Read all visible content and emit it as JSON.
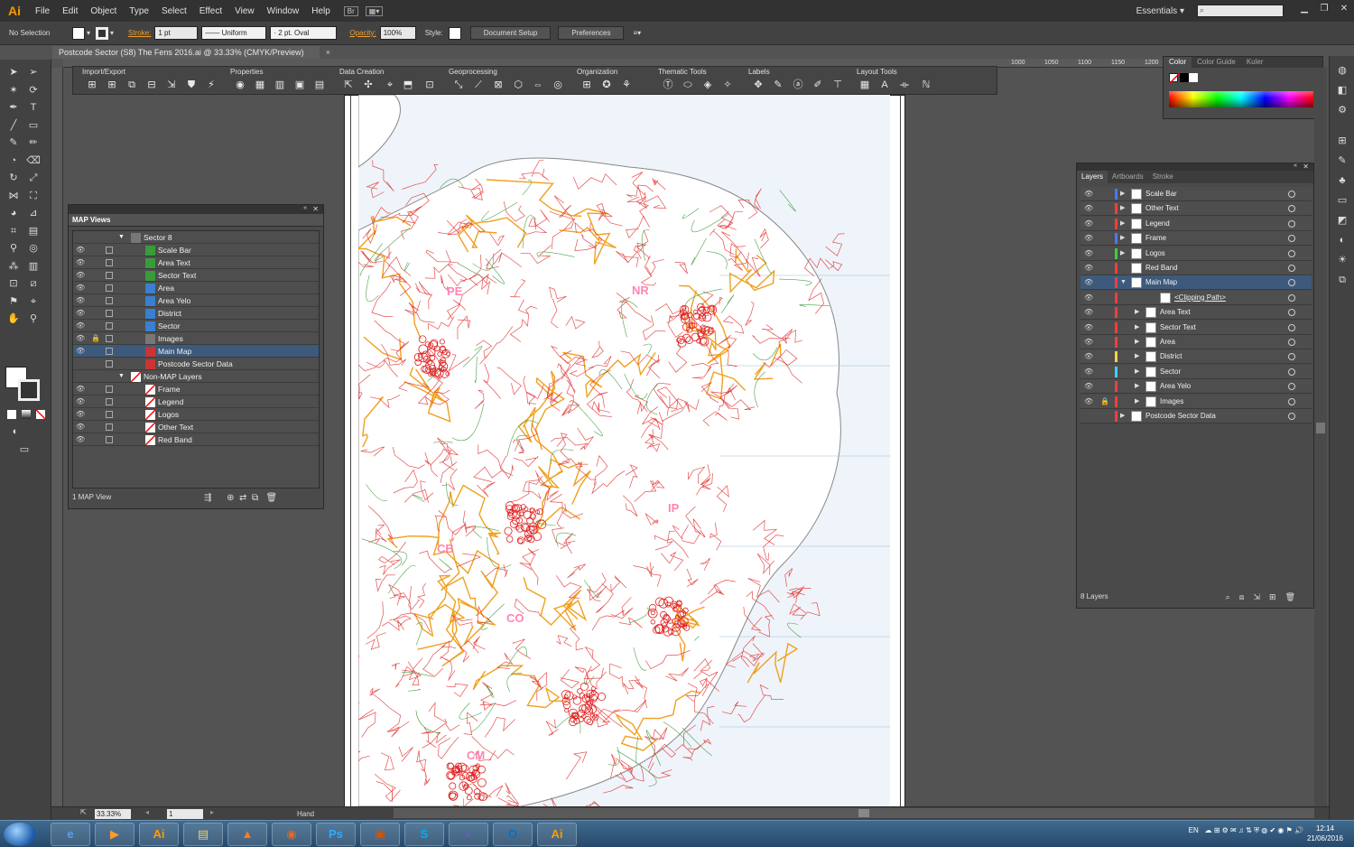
{
  "app": {
    "logo": "Ai",
    "workspace": "Essentials"
  },
  "menu": [
    "File",
    "Edit",
    "Object",
    "Type",
    "Select",
    "Effect",
    "View",
    "Window",
    "Help"
  ],
  "menu_extras": {
    "bridge": "Br"
  },
  "control": {
    "selection": "No Selection",
    "stroke_label": "Stroke:",
    "stroke_weight": "1 pt",
    "profile": "Uniform",
    "brush": "2 pt. Oval",
    "opacity_label": "Opacity:",
    "opacity": "100%",
    "style_label": "Style:",
    "document_setup": "Document Setup",
    "preferences": "Preferences"
  },
  "document": {
    "tab": "Postcode Sector (S8) The Fens 2016.ai @ 33.33% (CMYK/Preview)",
    "close": "×"
  },
  "ruler_ticks": [
    "1000",
    "1050",
    "1100",
    "1150",
    "1200"
  ],
  "map_toolbar": {
    "groups": [
      "Import/Export",
      "Properties",
      "Data Creation",
      "Geoprocessing",
      "Organization",
      "Thematic Tools",
      "Labels",
      "Layout Tools"
    ]
  },
  "map_views": {
    "title": "MAP Views",
    "group1": "Sector 8",
    "items1": [
      {
        "name": "Scale Bar",
        "icon": "text",
        "locked": false
      },
      {
        "name": "Area Text",
        "icon": "text",
        "locked": false
      },
      {
        "name": "Sector Text",
        "icon": "text",
        "locked": false
      },
      {
        "name": "Area",
        "icon": "area",
        "locked": false
      },
      {
        "name": "Area Yelo",
        "icon": "area",
        "locked": false
      },
      {
        "name": "District",
        "icon": "area",
        "locked": false
      },
      {
        "name": "Sector",
        "icon": "area",
        "locked": false
      },
      {
        "name": "Images",
        "icon": "image",
        "locked": true
      },
      {
        "name": "Main Map",
        "icon": "map",
        "locked": false,
        "selected": true
      },
      {
        "name": "Postcode Sector Data",
        "icon": "map",
        "locked": false,
        "hidden": true
      }
    ],
    "group2": "Non-MAP Layers",
    "items2": [
      "Frame",
      "Legend",
      "Logos",
      "Other Text",
      "Red Band"
    ],
    "footer": "1 MAP View"
  },
  "color_panel": {
    "tabs": [
      "Color",
      "Color Guide",
      "Kuler"
    ]
  },
  "layers_panel": {
    "tabs": [
      "Layers",
      "Artboards",
      "Stroke"
    ],
    "rows": [
      {
        "name": "Scale Bar",
        "level": 0,
        "color": "#4a78ff",
        "expand": true
      },
      {
        "name": "Other Text",
        "level": 0,
        "color": "#ff3b3b",
        "expand": true
      },
      {
        "name": "Legend",
        "level": 0,
        "color": "#ff3b3b",
        "expand": true
      },
      {
        "name": "Frame",
        "level": 0,
        "color": "#4a78ff",
        "expand": true
      },
      {
        "name": "Logos",
        "level": 0,
        "color": "#3bd13b",
        "expand": true
      },
      {
        "name": "Red Band",
        "level": 0,
        "color": "#ff3b3b",
        "expand": false
      },
      {
        "name": "Main Map",
        "level": 0,
        "color": "#ff3b3b",
        "expand": true,
        "open": true,
        "selected": true
      },
      {
        "name": "<Clipping Path>",
        "level": 2,
        "color": "#ff3b3b",
        "expand": false,
        "underline": true
      },
      {
        "name": "Area Text",
        "level": 1,
        "color": "#ff3b3b",
        "expand": true
      },
      {
        "name": "Sector Text",
        "level": 1,
        "color": "#ff3b3b",
        "expand": true
      },
      {
        "name": "Area",
        "level": 1,
        "color": "#ff3b3b",
        "expand": true
      },
      {
        "name": "District",
        "level": 1,
        "color": "#ffd23b",
        "expand": true
      },
      {
        "name": "Sector",
        "level": 1,
        "color": "#3bd1ff",
        "expand": true
      },
      {
        "name": "Area Yelo",
        "level": 1,
        "color": "#ff3b3b",
        "expand": true
      },
      {
        "name": "Images",
        "level": 1,
        "color": "#ff3b3b",
        "expand": true,
        "locked": true
      },
      {
        "name": "Postcode Sector Data",
        "level": 0,
        "color": "#ff3b3b",
        "expand": true,
        "hidden": true
      }
    ],
    "footer": "8 Layers"
  },
  "map_labels": [
    "PE",
    "NR",
    "IP",
    "CB",
    "CO",
    "CM"
  ],
  "status": {
    "zoom": "33.33%",
    "page": "1",
    "tool": "Hand"
  },
  "taskbar": {
    "apps": [
      "e",
      "▶",
      "Ai",
      "▤",
      "▲",
      "◉",
      "Ps",
      "▣",
      "S",
      "◐",
      "O",
      "Ai"
    ],
    "language": "EN",
    "time": "12:14",
    "date": "21/06/2016"
  }
}
